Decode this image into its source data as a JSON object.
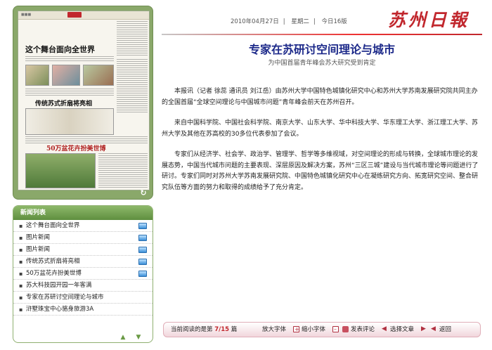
{
  "header": {
    "date": "2010年04月27日",
    "weekday": "星期二",
    "edition": "今日16版",
    "logo": "苏州日報"
  },
  "article": {
    "title": "专家在苏研讨空间理论与城市",
    "subtitle": "为中国首届青年峰会苏大研究受到肯定",
    "paragraphs": [
      "本报讯（记者 徐蕊 通讯员 刘江岳）由苏州大学中国特色城镇化研究中心和苏州大学苏南发展研究院共同主办的全国首届“全球空间理论与中国城市问题”青年峰会前天在苏州召开。",
      "来自中国科学院、中国社会科学院、南京大学、山东大学、华中科技大学、华东理工大学、浙江理工大学、苏州大学及其他在苏高校的30多位代表参加了会议。",
      "专家们从经济学、社会学、政治学、管理学、哲学等多维视域，对空间理论的形成与转换，全球城市理论的发展态势，中国当代城市问题的主要表现、深层原因及解决方案，苏州“三区三城”建设与当代城市理论等问题进行了研讨。专家们同时对苏州大学苏南发展研究院、中国特色城镇化研究中心在凝练研究方向、拓宽研究空间、整合研究队伍等方面的努力和取得的成绩给予了充分肯定。"
    ]
  },
  "thumbnail": {
    "headline_1": "这个舞台面向全世界",
    "headline_2": "传统苏式折扇将亮相",
    "headline_3": "50万盆花卉扮美世博"
  },
  "news_list": {
    "header": "新闻列表",
    "items": [
      {
        "label": "这个舞台面向全世界",
        "has_pic": true
      },
      {
        "label": "图片新闻",
        "has_pic": true
      },
      {
        "label": "图片新闻",
        "has_pic": true
      },
      {
        "label": "传统苏式折扇将亮相",
        "has_pic": true
      },
      {
        "label": "50万盆花卉扮美世博",
        "has_pic": true
      },
      {
        "label": "苏大科技园开园一年客满",
        "has_pic": false
      },
      {
        "label": "专家在苏研讨空间理论与城市",
        "has_pic": false
      },
      {
        "label": "浒墅珠宝中心骆身旅游3A",
        "has_pic": false
      }
    ]
  },
  "bottom_bar": {
    "reading_prefix": "当前阅读的是第",
    "current": "7/15",
    "reading_suffix": "篇",
    "zoom_in": "放大字体",
    "zoom_out": "缩小字体",
    "comment": "发表评论",
    "prev": "选择文章",
    "back": "返回"
  },
  "colors": {
    "accent_red": "#c1272d",
    "title_blue": "#1d2a8a",
    "panel_green": "#6f9a4c"
  }
}
